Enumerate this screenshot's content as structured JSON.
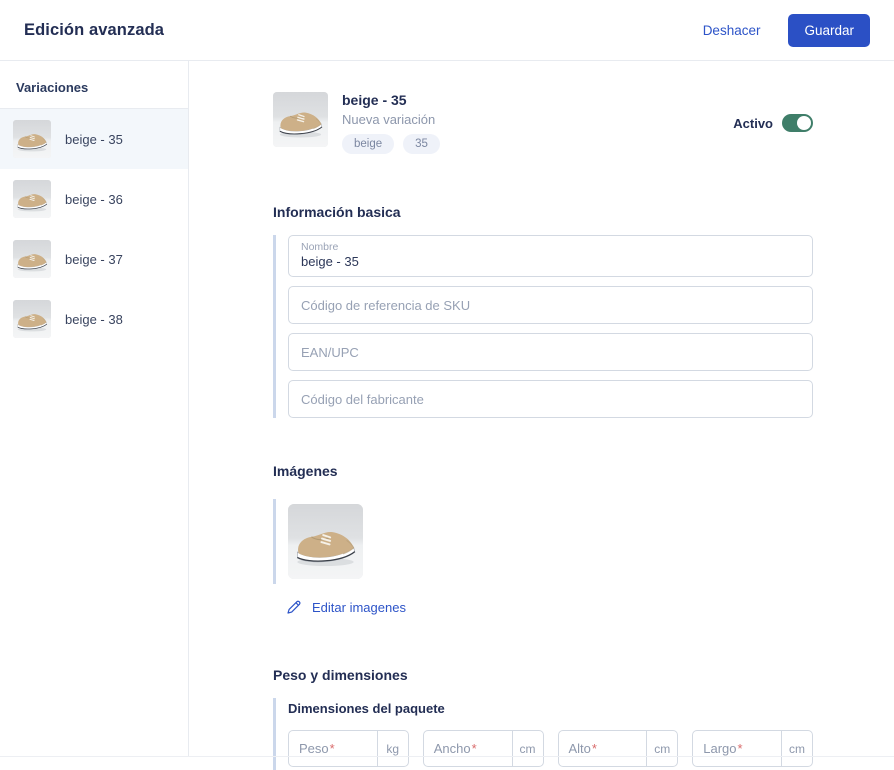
{
  "header": {
    "title": "Edición avanzada",
    "undo_label": "Deshacer",
    "save_label": "Guardar"
  },
  "sidebar": {
    "title": "Variaciones",
    "items": [
      {
        "label": "beige - 35",
        "selected": true
      },
      {
        "label": "beige - 36",
        "selected": false
      },
      {
        "label": "beige - 37",
        "selected": false
      },
      {
        "label": "beige - 38",
        "selected": false
      }
    ]
  },
  "product": {
    "name": "beige - 35",
    "status": "Nueva variación",
    "chips": [
      "beige",
      "35"
    ],
    "active_label": "Activo",
    "active": true
  },
  "basic_info": {
    "title": "Información basica",
    "name_field": {
      "label": "Nombre",
      "value": "beige - 35"
    },
    "fields": [
      {
        "placeholder": "Código de referencia de SKU"
      },
      {
        "placeholder": "EAN/UPC"
      },
      {
        "placeholder": "Código del fabricante"
      }
    ]
  },
  "images": {
    "title": "Imágenes",
    "edit_label": "Editar imagenes"
  },
  "dimensions": {
    "title": "Peso y dimensiones",
    "subtitle": "Dimensiones del paquete",
    "fields": [
      {
        "label": "Peso",
        "required": true,
        "unit": "kg"
      },
      {
        "label": "Ancho",
        "required": true,
        "unit": "cm"
      },
      {
        "label": "Alto",
        "required": true,
        "unit": "cm"
      },
      {
        "label": "Largo",
        "required": true,
        "unit": "cm"
      }
    ]
  },
  "colors": {
    "primary_blue": "#2B50C5",
    "link_blue": "#2D54C8",
    "accent_bar": "#CBD7EB",
    "toggle_green": "#3F7E69",
    "required_red": "#D96B6B",
    "selected_row_bg": "#F3F7FB",
    "border": "#D3D9E2"
  }
}
